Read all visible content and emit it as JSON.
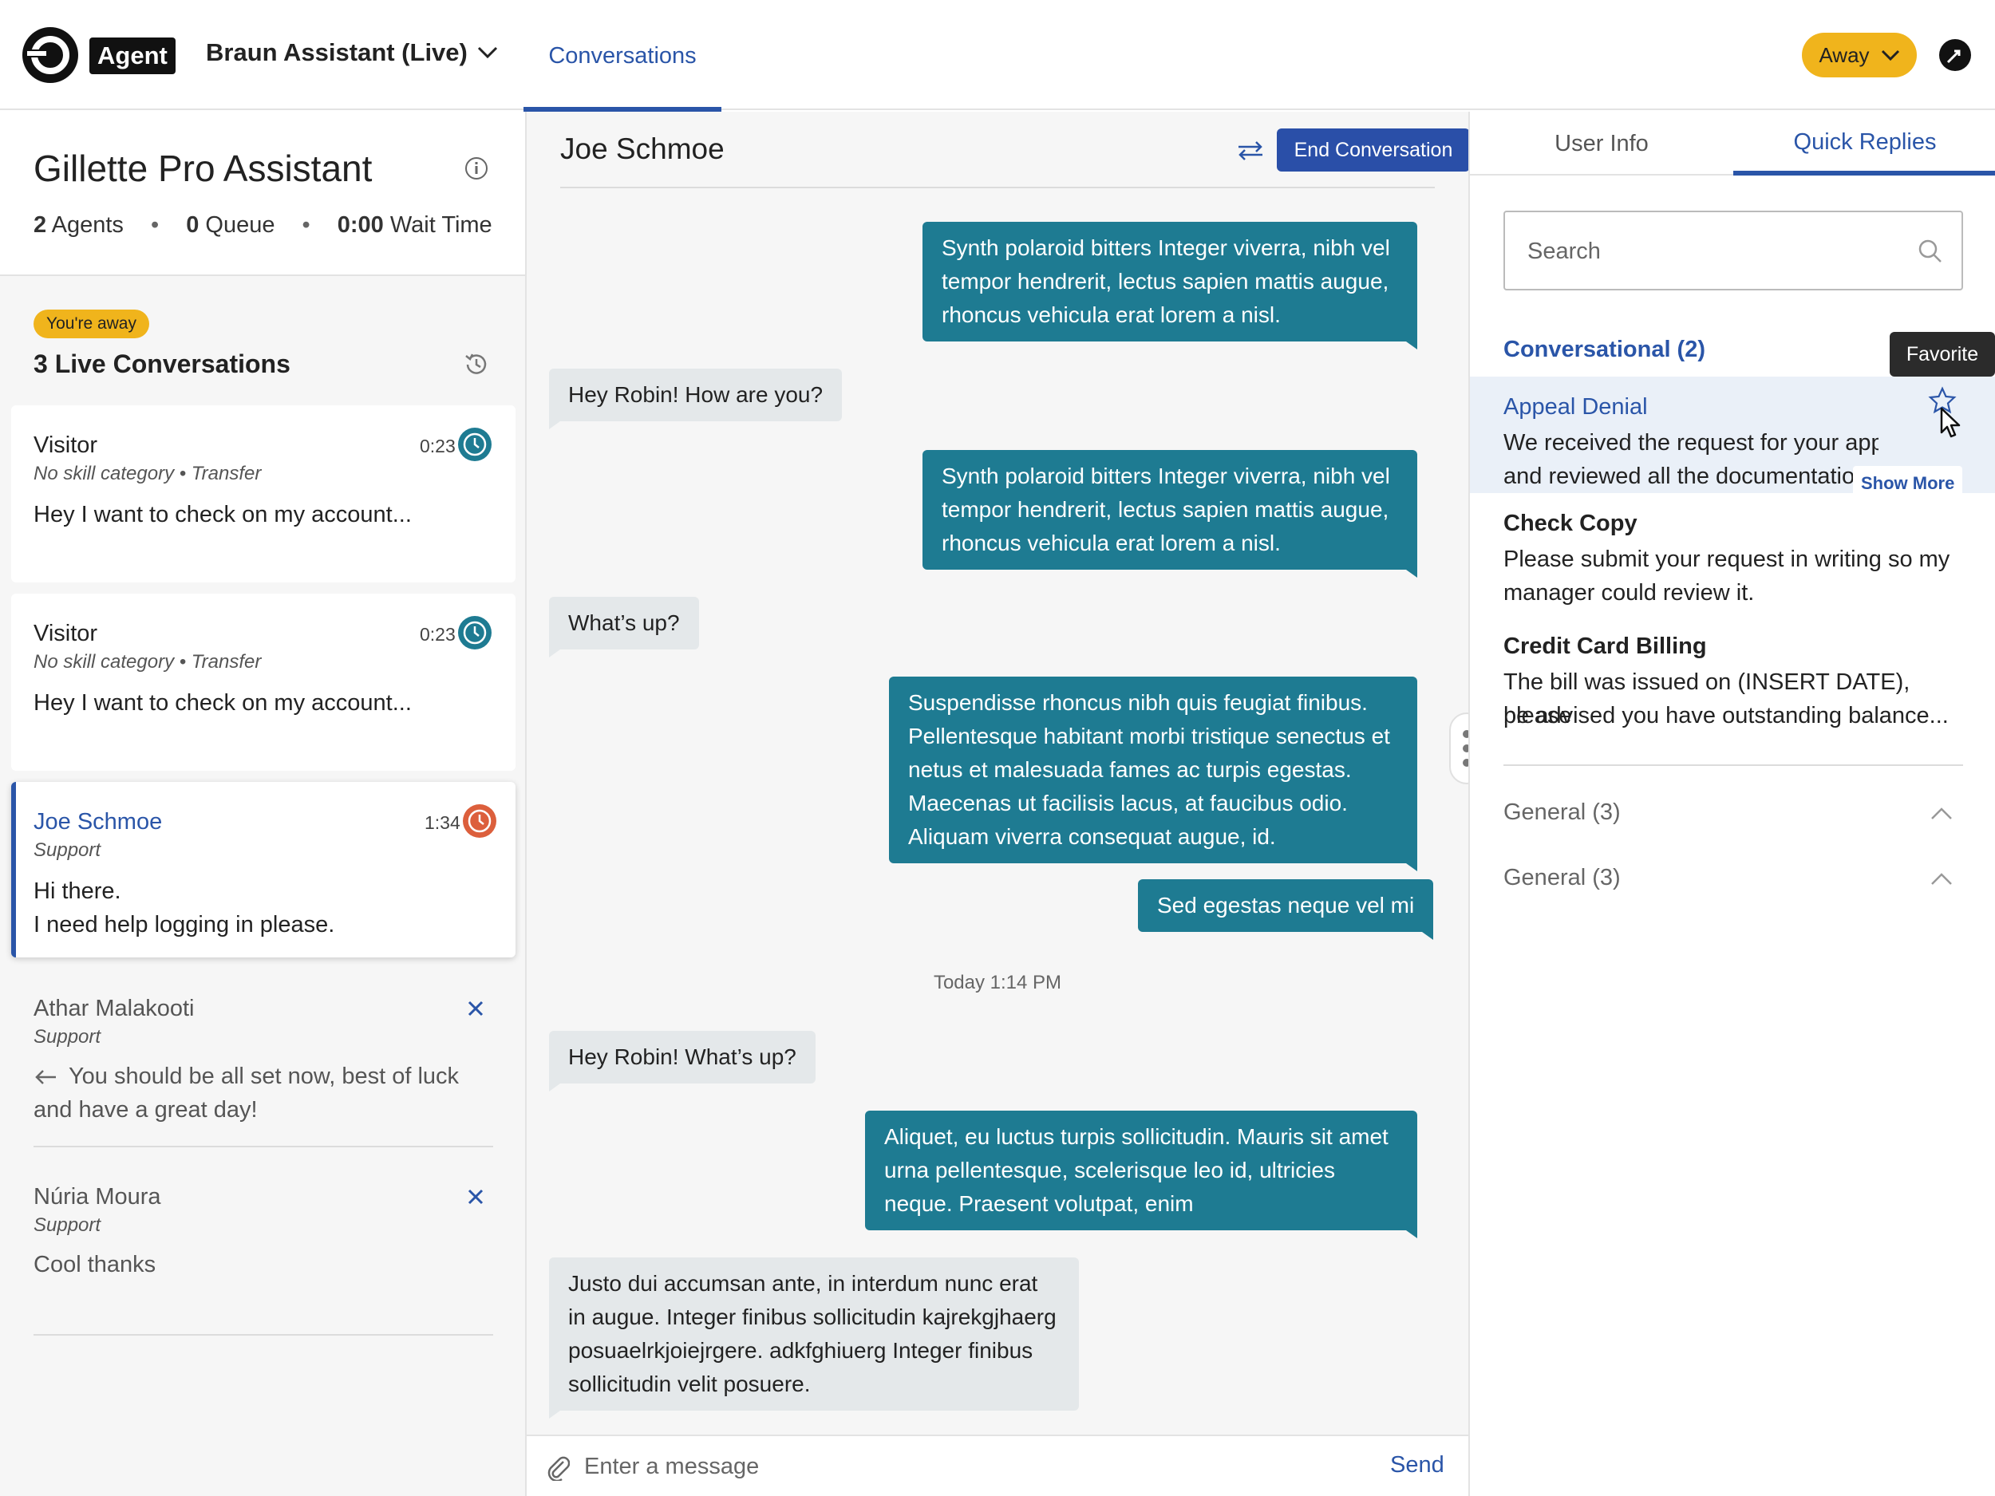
{
  "topbar": {
    "agent_label": "Agent",
    "workspace": "Braun Assistant (Live)",
    "nav_tab": "Conversations",
    "status": "Away"
  },
  "left": {
    "team_name": "Gillette Pro Assistant",
    "stats": {
      "agents_count": "2",
      "agents_label": "Agents",
      "queue_count": "0",
      "queue_label": "Queue",
      "wait_value": "0:00",
      "wait_label": "Wait Time"
    },
    "away_badge": "You're away",
    "live_title": "3 Live Conversations",
    "live": [
      {
        "name": "Visitor",
        "category": "No skill category • Transfer",
        "message": "Hey I want to check on my account...",
        "time": "0:23",
        "clock_color": "#1e7b92"
      },
      {
        "name": "Visitor",
        "category": "No skill category • Transfer",
        "message": "Hey I want to check on my account...",
        "time": "0:23",
        "clock_color": "#1e7b92"
      },
      {
        "name": "Joe Schmoe",
        "category": "Support",
        "message_line1": "Hi there.",
        "message_line2": "I need help logging in please.",
        "time": "1:34",
        "clock_color": "#dc5f3c"
      }
    ],
    "closed": [
      {
        "name": "Athar Malakooti",
        "category": "Support",
        "message": "You should be all set now, best of luck and have a great day!"
      },
      {
        "name": "Núria Moura",
        "category": "Support",
        "message": "Cool thanks"
      }
    ]
  },
  "chat": {
    "title": "Joe Schmoe",
    "end_label": "End Conversation",
    "messages": [
      {
        "dir": "out",
        "text": "Synth polaroid bitters Integer viverra, nibh vel tempor hendrerit, lectus sapien mattis augue, rhoncus vehicula erat lorem a nisl."
      },
      {
        "dir": "in",
        "text": "Hey Robin! How are you?"
      },
      {
        "dir": "out",
        "text": "Synth polaroid bitters Integer viverra, nibh vel tempor hendrerit, lectus sapien mattis augue, rhoncus vehicula erat lorem a nisl."
      },
      {
        "dir": "in",
        "text": "What’s up?"
      },
      {
        "dir": "out",
        "text": "Suspendisse rhoncus nibh quis feugiat finibus. Pellentesque habitant morbi tristique senectus et netus et malesuada fames ac turpis egestas. Maecenas ut facilisis lacus, at faucibus odio. Aliquam viverra consequat augue, id."
      },
      {
        "dir": "out",
        "text": "Sed egestas neque vel mi"
      },
      {
        "dir": "in",
        "text": "Hey Robin! What’s up?"
      },
      {
        "dir": "out",
        "text": "Aliquet, eu luctus turpis sollicitudin. Mauris sit amet urna pellentesque, scelerisque leo id, ultricies neque. Praesent volutpat, enim"
      },
      {
        "dir": "in",
        "text": "Justo dui accumsan ante, in interdum nunc erat in augue. Integer finibus sollicitudin kajrekgjhaerg posuaelrkjoiejrgere. adkfghiuerg Integer finibus sollicitudin velit posuere."
      }
    ],
    "timestamp": "Today 1:14 PM",
    "composer_placeholder": "Enter a message",
    "send_label": "Send"
  },
  "right": {
    "tab_user_info": "User Info",
    "tab_quick_replies": "Quick Replies",
    "search_placeholder": "Search",
    "conversational_title": "Conversational (2)",
    "tooltip": "Favorite",
    "replies": [
      {
        "title": "Appeal Denial",
        "line1": "We received the request for your appeal",
        "line2": "and reviewed all the documentation",
        "show_more": "Show More"
      },
      {
        "title": "Check Copy",
        "line1": "Please submit your request in writing so my",
        "line2": "manager could review it."
      },
      {
        "title": "Credit Card Billing",
        "line1": "The bill was issued on (INSERT DATE), please",
        "line2": "be advised you have outstanding balance..."
      }
    ],
    "general": [
      "General (3)",
      "General (3)"
    ]
  },
  "colors": {
    "accent": "#2a55a8",
    "teal": "#1e7b92",
    "away": "#f0b41c",
    "urgent": "#dc5f3c"
  },
  "icons": [
    "logo-icon",
    "chevron-down-icon",
    "swap-icon",
    "info-icon",
    "history-icon",
    "clock-icon",
    "close-icon",
    "arrow-left-icon",
    "transfer-icon",
    "paperclip-icon",
    "search-icon",
    "star-icon",
    "chevron-up-icon",
    "cursor-icon"
  ]
}
